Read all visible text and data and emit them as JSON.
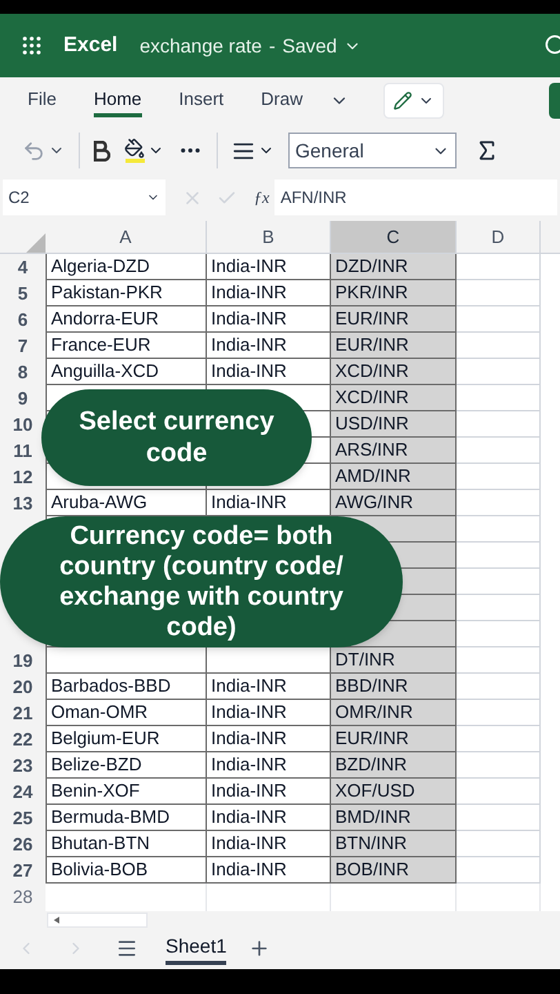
{
  "app_bar": {
    "app": "Excel",
    "document": "exchange rate",
    "separator": "-",
    "status": "Saved"
  },
  "ribbon_tabs": [
    {
      "label": "File",
      "selected": false
    },
    {
      "label": "Home",
      "selected": true
    },
    {
      "label": "Insert",
      "selected": false
    },
    {
      "label": "Draw",
      "selected": false
    }
  ],
  "toolbar": {
    "number_format": "General"
  },
  "formula_bar": {
    "cell": "C2",
    "function_label": "ƒx",
    "formula": "AFN/INR"
  },
  "sheet": {
    "columns": [
      {
        "label": "A",
        "selected": false
      },
      {
        "label": "B",
        "selected": false
      },
      {
        "label": "C",
        "selected": true
      },
      {
        "label": "D",
        "selected": false
      }
    ],
    "rows": [
      {
        "number": "4",
        "a": "Algeria-DZD",
        "b": "India-INR",
        "c": "DZD/INR"
      },
      {
        "number": "5",
        "a": "Pakistan-PKR",
        "b": "India-INR",
        "c": "PKR/INR"
      },
      {
        "number": "6",
        "a": "Andorra-EUR",
        "b": "India-INR",
        "c": "EUR/INR"
      },
      {
        "number": "7",
        "a": "France-EUR",
        "b": "India-INR",
        "c": "EUR/INR"
      },
      {
        "number": "8",
        "a": "Anguilla-XCD",
        "b": "India-INR",
        "c": "XCD/INR"
      },
      {
        "number": "9",
        "c": "XCD/INR"
      },
      {
        "number": "10",
        "c": "USD/INR"
      },
      {
        "number": "11",
        "c": "ARS/INR"
      },
      {
        "number": "12",
        "c": "AMD/INR"
      },
      {
        "number": "13",
        "a": "Aruba-AWG",
        "b": "India-INR",
        "c": "AWG/INR"
      },
      {},
      {},
      {},
      {},
      {},
      {
        "number": "19",
        "c": "DT/INR"
      },
      {
        "number": "20",
        "a": "Barbados-BBD",
        "b": "India-INR",
        "c": "BBD/INR"
      },
      {
        "number": "21",
        "a": "Oman-OMR",
        "b": "India-INR",
        "c": "OMR/INR"
      },
      {
        "number": "22",
        "a": "Belgium-EUR",
        "b": "India-INR",
        "c": "EUR/INR"
      },
      {
        "number": "23",
        "a": "Belize-BZD",
        "b": "India-INR",
        "c": "BZD/INR"
      },
      {
        "number": "24",
        "a": "Benin-XOF",
        "b": "India-INR",
        "c": "XOF/USD"
      },
      {
        "number": "25",
        "a": "Bermuda-BMD",
        "b": "India-INR",
        "c": "BMD/INR"
      },
      {
        "number": "26",
        "a": "Bhutan-BTN",
        "b": "India-INR",
        "c": "BTN/INR"
      },
      {
        "number": "27",
        "a": "Bolivia-BOB",
        "b": "India-INR",
        "c": "BOB/INR"
      }
    ],
    "last_row": "28"
  },
  "callouts": [
    {
      "text": "Select currency code"
    },
    {
      "text": "Currency code= both country (country code/ exchange with country code)"
    }
  ],
  "sheet_tabs": [
    {
      "label": "Sheet1",
      "selected": true
    }
  ]
}
